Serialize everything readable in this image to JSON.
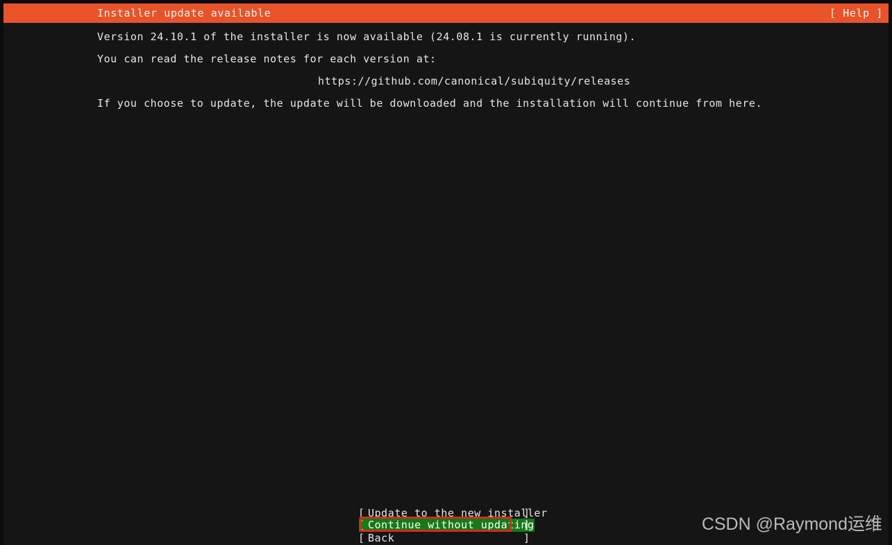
{
  "window": {
    "title": "Installer update available",
    "help_label": "[ Help ]",
    "accent_color": "#e8532a",
    "background_color": "#151515",
    "text_color": "#e6e6e6",
    "selection_color": "#167a17",
    "annotation_color": "#d42b20"
  },
  "body": {
    "line_1": "Version 24.10.1 of the installer is now available (24.08.1 is currently running).",
    "line_2": "You can read the release notes for each version at:",
    "release_notes_url": "https://github.com/canonical/subiquity/releases",
    "line_3": "If you choose to update, the update will be downloaded and the installation will continue from here."
  },
  "buttons": [
    {
      "label": "Update to the new installer",
      "bracket_left": "[",
      "bracket_right": "]",
      "selected": false
    },
    {
      "label": "Continue without updating",
      "bracket_left": "[",
      "bracket_right": "]",
      "selected": true
    },
    {
      "label": "Back",
      "bracket_left": "[",
      "bracket_right": "]",
      "selected": false
    }
  ],
  "watermark": {
    "text": "CSDN @Raymond运维"
  }
}
